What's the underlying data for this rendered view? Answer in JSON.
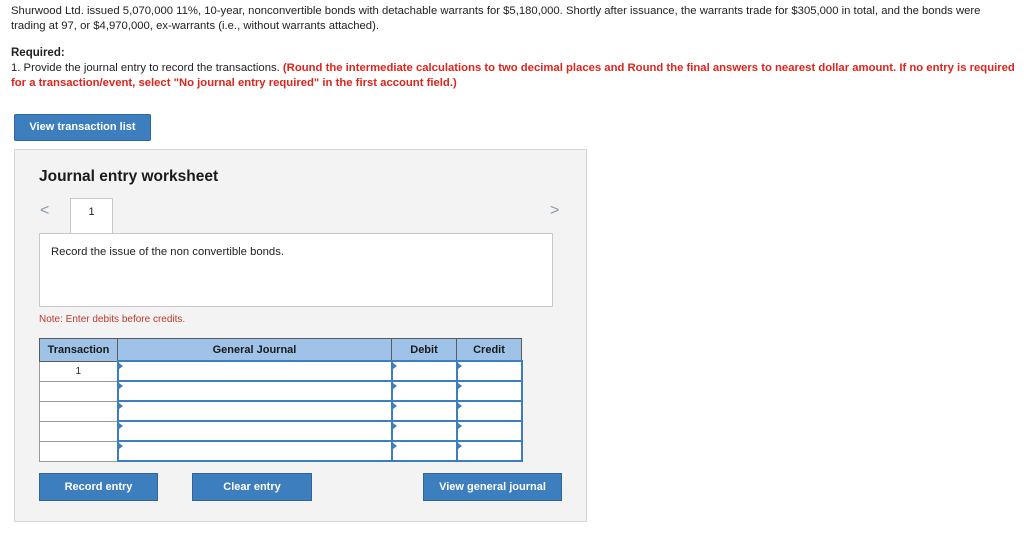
{
  "problem": {
    "text": "Shurwood Ltd. issued 5,070,000 11%, 10-year, nonconvertible bonds with detachable warrants for $5,180,000. Shortly after issuance, the warrants trade for $305,000 in total, and the bonds were trading at 97, or $4,970,000, ex-warrants (i.e., without warrants attached)."
  },
  "required": {
    "title": "Required:",
    "item_prefix": "1. Provide the journal entry to record the transactions.",
    "instruction": "(Round the intermediate calculations to two decimal places and Round the final answers to nearest dollar amount. If no entry is required for a transaction/event, select \"No journal entry required\" in the first account field.)"
  },
  "buttons": {
    "view_transaction_list": "View transaction list",
    "record_entry": "Record entry",
    "clear_entry": "Clear entry",
    "view_general_journal": "View general journal"
  },
  "worksheet": {
    "title": "Journal entry worksheet",
    "prev_icon": "<",
    "next_icon": ">",
    "current_tab": "1",
    "description": "Record the issue of the non convertible bonds.",
    "note": "Note: Enter debits before credits."
  },
  "table": {
    "headers": {
      "transaction": "Transaction",
      "account": "General Journal",
      "debit": "Debit",
      "credit": "Credit"
    },
    "rows": [
      {
        "transaction": "1",
        "account": "",
        "debit": "",
        "credit": ""
      },
      {
        "transaction": "",
        "account": "",
        "debit": "",
        "credit": ""
      },
      {
        "transaction": "",
        "account": "",
        "debit": "",
        "credit": ""
      },
      {
        "transaction": "",
        "account": "",
        "debit": "",
        "credit": ""
      },
      {
        "transaction": "",
        "account": "",
        "debit": "",
        "credit": ""
      }
    ]
  },
  "colors": {
    "button": "#3d7ebf",
    "header": "#9fc3e8",
    "required_text": "#e0231b"
  }
}
